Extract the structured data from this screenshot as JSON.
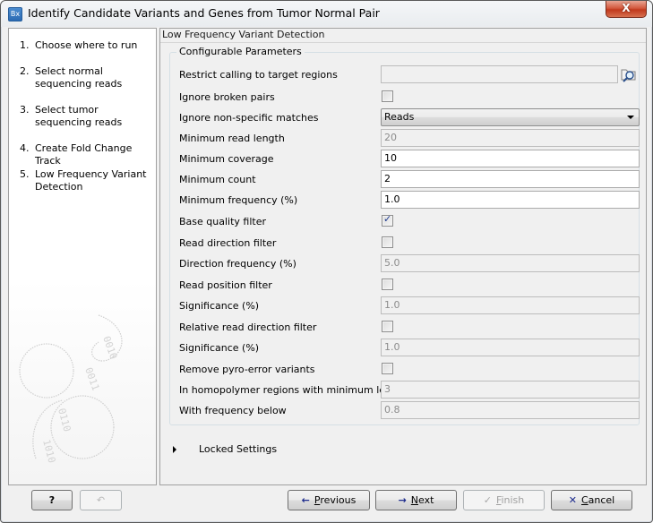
{
  "window": {
    "title": "Identify Candidate Variants and Genes from Tumor Normal Pair",
    "app_icon_text": "Bx",
    "close_label": "X"
  },
  "steps": [
    {
      "num": "1.",
      "label": "Choose where to run"
    },
    {
      "num": "2.",
      "label": "Select normal sequencing reads"
    },
    {
      "num": "3.",
      "label": "Select tumor sequencing reads"
    },
    {
      "num": "4.",
      "label": "Create Fold Change Track"
    },
    {
      "num": "5.",
      "label": "Low Frequency Variant Detection"
    }
  ],
  "main": {
    "header": "Low Frequency Variant Detection",
    "group_title": "Configurable Parameters",
    "params": {
      "restrict_calling": {
        "label": "Restrict calling to target regions",
        "value": ""
      },
      "ignore_broken_pairs": {
        "label": "Ignore broken pairs",
        "checked": false
      },
      "ignore_nonspecific": {
        "label": "Ignore non-specific matches",
        "value": "Reads"
      },
      "min_read_length": {
        "label": "Minimum read length",
        "value": "20",
        "enabled": false
      },
      "min_coverage": {
        "label": "Minimum coverage",
        "value": "10"
      },
      "min_count": {
        "label": "Minimum count",
        "value": "2"
      },
      "min_frequency": {
        "label": "Minimum frequency (%)",
        "value": "1.0"
      },
      "base_quality_filter": {
        "label": "Base quality filter",
        "checked": true
      },
      "read_direction_filter": {
        "label": "Read direction filter",
        "checked": false
      },
      "direction_frequency": {
        "label": "Direction frequency (%)",
        "value": "5.0",
        "enabled": false
      },
      "read_position_filter": {
        "label": "Read position filter",
        "checked": false
      },
      "significance_1": {
        "label": "Significance (%)",
        "value": "1.0",
        "enabled": false
      },
      "relative_read_direction_filter": {
        "label": "Relative read direction filter",
        "checked": false
      },
      "significance_2": {
        "label": "Significance (%)",
        "value": "1.0",
        "enabled": false
      },
      "remove_pyro_error": {
        "label": "Remove pyro-error variants",
        "checked": false
      },
      "homopolymer_min_length": {
        "label": "In homopolymer regions with minimum length",
        "value": "3",
        "enabled": false
      },
      "with_frequency_below": {
        "label": "With frequency below",
        "value": "0.8",
        "enabled": false
      }
    },
    "locked_settings_label": "Locked Settings"
  },
  "footer": {
    "help_label": "?",
    "previous_label": "Previous",
    "previous_mnemonic": "P",
    "next_label": "Next",
    "next_mnemonic": "N",
    "finish_label": "Finish",
    "finish_mnemonic": "F",
    "cancel_label": "Cancel",
    "cancel_mnemonic": "C"
  }
}
